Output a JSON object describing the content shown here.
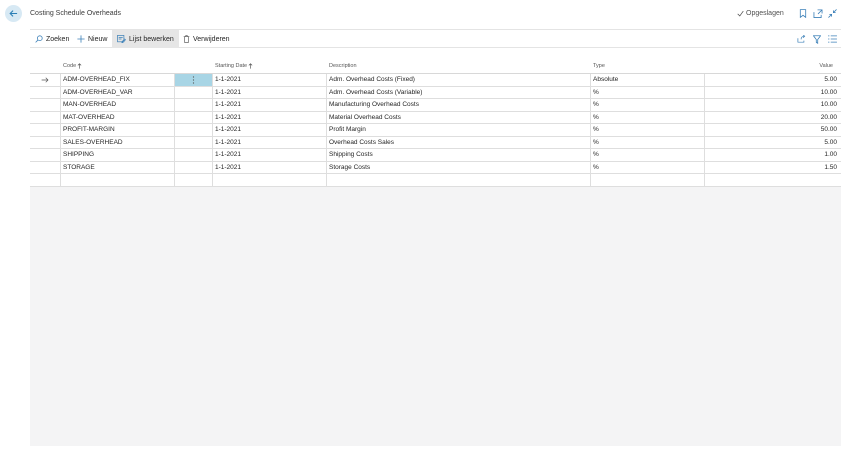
{
  "header": {
    "title": "Costing Schedule Overheads",
    "saved_label": "Opgeslagen"
  },
  "toolbar": {
    "search_label": "Zoeken",
    "new_label": "Nieuw",
    "edit_list_label": "Lijst bewerken",
    "delete_label": "Verwijderen"
  },
  "columns": {
    "code": "Code",
    "starting_date": "Starting Date",
    "description": "Description",
    "type": "Type",
    "value": "Value"
  },
  "rows": [
    {
      "code": "ADM-OVERHEAD_FIX",
      "starting_date": "1-1-2021",
      "description": "Adm. Overhead Costs (Fixed)",
      "type": "Absolute",
      "value": "5.00"
    },
    {
      "code": "ADM-OVERHEAD_VAR",
      "starting_date": "1-1-2021",
      "description": "Adm. Overhead Costs (Variable)",
      "type": "%",
      "value": "10.00"
    },
    {
      "code": "MAN-OVERHEAD",
      "starting_date": "1-1-2021",
      "description": "Manufacturing Overhead Costs",
      "type": "%",
      "value": "10.00"
    },
    {
      "code": "MAT-OVERHEAD",
      "starting_date": "1-1-2021",
      "description": "Material Overhead Costs",
      "type": "%",
      "value": "20.00"
    },
    {
      "code": "PROFIT-MARGIN",
      "starting_date": "1-1-2021",
      "description": "Profit Margin",
      "type": "%",
      "value": "50.00"
    },
    {
      "code": "SALES-OVERHEAD",
      "starting_date": "1-1-2021",
      "description": "Overhead Costs Sales",
      "type": "%",
      "value": "5.00"
    },
    {
      "code": "SHIPPING",
      "starting_date": "1-1-2021",
      "description": "Shipping Costs",
      "type": "%",
      "value": "1.00"
    },
    {
      "code": "STORAGE",
      "starting_date": "1-1-2021",
      "description": "Storage Costs",
      "type": "%",
      "value": "1.50"
    }
  ],
  "icons": {
    "back": "arrow-left-icon",
    "saved": "checkmark-icon",
    "bookmark": "bookmark-icon",
    "open_new": "open-in-new-window-icon",
    "collapse": "collapse-icon",
    "search": "search-icon",
    "new": "plus-icon",
    "edit_list": "edit-list-icon",
    "delete": "trash-icon",
    "share": "share-icon",
    "filter": "filter-icon",
    "list_view": "list-view-icon",
    "row_selected": "arrow-right-icon",
    "row_menu": "vertical-ellipsis-icon",
    "sort_asc": "arrow-up-icon"
  },
  "colors": {
    "accent": "#2b7fb6",
    "back_button_bg": "#d7e9f4",
    "selected_cell": "#a8d5e5",
    "content_bg": "#f4f4f5"
  }
}
